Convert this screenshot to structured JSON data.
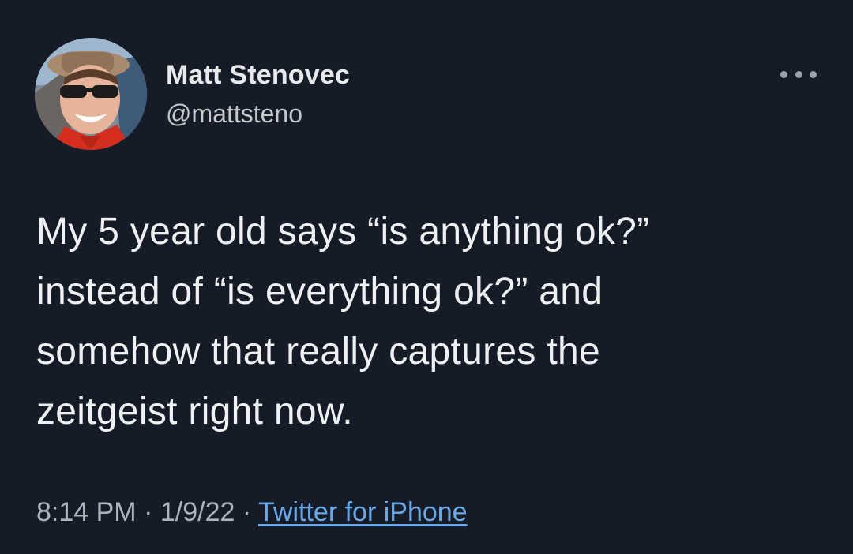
{
  "author": {
    "name": "Matt Stenovec",
    "handle": "@mattsteno"
  },
  "menu": {
    "icon": "more-horizontal-icon"
  },
  "tweet": {
    "lines": [
      "My 5 year old says “is anything ok?”",
      "instead of “is everything ok?” and",
      "somehow that really captures the",
      "zeitgeist right now."
    ]
  },
  "meta": {
    "time": "8:14 PM",
    "separator": "·",
    "date": "1/9/22",
    "source": "Twitter for iPhone"
  },
  "colors": {
    "background": "#161c27",
    "text": "#e7e9ea",
    "link": "#6aa8e8",
    "muted": "#aeb4ba"
  }
}
